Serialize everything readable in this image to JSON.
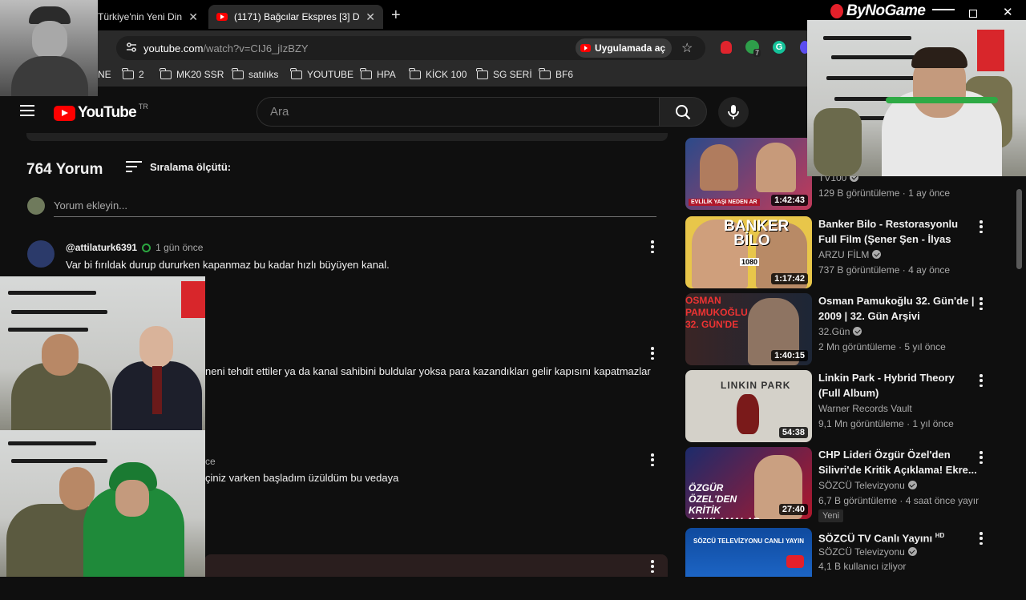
{
  "browser": {
    "tabs": [
      {
        "label": "Türkiye'nin Yeni Din",
        "active": false
      },
      {
        "label": "(1171) Bağcılar Ekspres [3] D",
        "active": true
      }
    ],
    "new_tab": "+",
    "url_host": "youtube.com",
    "url_path": "/watch?v=CIJ6_jIzBZY",
    "open_in_app": "Uygulamada aç",
    "bookmarks": [
      "NE",
      "2",
      "MK20 SSR",
      "satılıks",
      "YOUTUBE",
      "HPA",
      "KİCK 100",
      "SG SERİ",
      "BF6"
    ],
    "extension_badge": "7"
  },
  "youtube": {
    "logo": "YouTube",
    "region": "TR",
    "search_placeholder": "Ara"
  },
  "comments": {
    "count_label": "764 Yorum",
    "sort_label": "Sıralama ölçütü:",
    "add_placeholder": "Yorum ekleyin...",
    "items": [
      {
        "author": "@attilaturk6391",
        "time": "1 gün önce",
        "text": "Var bi fırıldak durup dururken kapanmaz bu kadar hızlı büyüyen kanal."
      },
      {
        "author": "",
        "time": "",
        "text": "neni tehdit ettiler ya da kanal sahibini buldular yoksa para kazandıkları gelir kapısını kapatmazlar"
      },
      {
        "author": "",
        "time": "ce",
        "text": "çiniz varken başladım üzüldüm bu vedaya"
      }
    ]
  },
  "sidebar": {
    "videos": [
      {
        "title": "",
        "channel": "TV100",
        "meta": "129 B görüntüleme · 1 ay önce",
        "duration": "1:42:43",
        "verified": true,
        "thumb_caption": "EVLİLİK YAŞI NEDEN AR"
      },
      {
        "title": "Banker Bilo - Restorasyonlu Full Film (Şener Şen - İlyas Salman)",
        "channel": "ARZU FİLM",
        "meta": "737 B görüntüleme · 4 ay önce",
        "duration": "1:17:42",
        "verified": true,
        "thumb_caption": "BANKER BİLO",
        "thumb_badge": "1080"
      },
      {
        "title": "Osman Pamukoğlu 32. Gün'de | 2009 | 32. Gün Arşivi",
        "channel": "32.Gün",
        "meta": "2 Mn görüntüleme · 5 yıl önce",
        "duration": "1:40:15",
        "verified": true,
        "thumb_caption": "OSMAN PAMUKOĞLU 32. GÜN'DE"
      },
      {
        "title": "Linkin Park - Hybrid Theory (Full Album)",
        "channel": "Warner Records Vault",
        "meta": "9,1 Mn görüntüleme · 1 yıl önce",
        "duration": "54:38",
        "verified": false,
        "thumb_caption": "LINKIN PARK"
      },
      {
        "title": "CHP Lideri Özgür Özel'den Silivri'de Kritik Açıklama! Ekre...",
        "channel": "SÖZCÜ Televizyonu",
        "meta": "6,7 B görüntüleme · 4 saat önce yayınlan...",
        "duration": "27:40",
        "verified": true,
        "badge": "Yeni",
        "thumb_caption": "ÖZGÜR ÖZEL'DEN KRİTİK AÇIKLAMALAR"
      },
      {
        "title": "SÖZCÜ TV Canlı Yayını",
        "title_badge": "HD",
        "channel": "SÖZCÜ Televizyonu",
        "meta": "4,1 B kullanıcı izliyor",
        "duration": "",
        "verified": true,
        "thumb_caption": "SÖZCÜ TELEVİZYONU CANLI YAYIN"
      }
    ]
  },
  "overlay": {
    "brand": "ByNoGame"
  },
  "colors": {
    "page_bg": "#0f0f0f",
    "youtube_red": "#ff0000",
    "browser_chrome": "#2a2a2a",
    "flag_red": "#d8262b"
  }
}
